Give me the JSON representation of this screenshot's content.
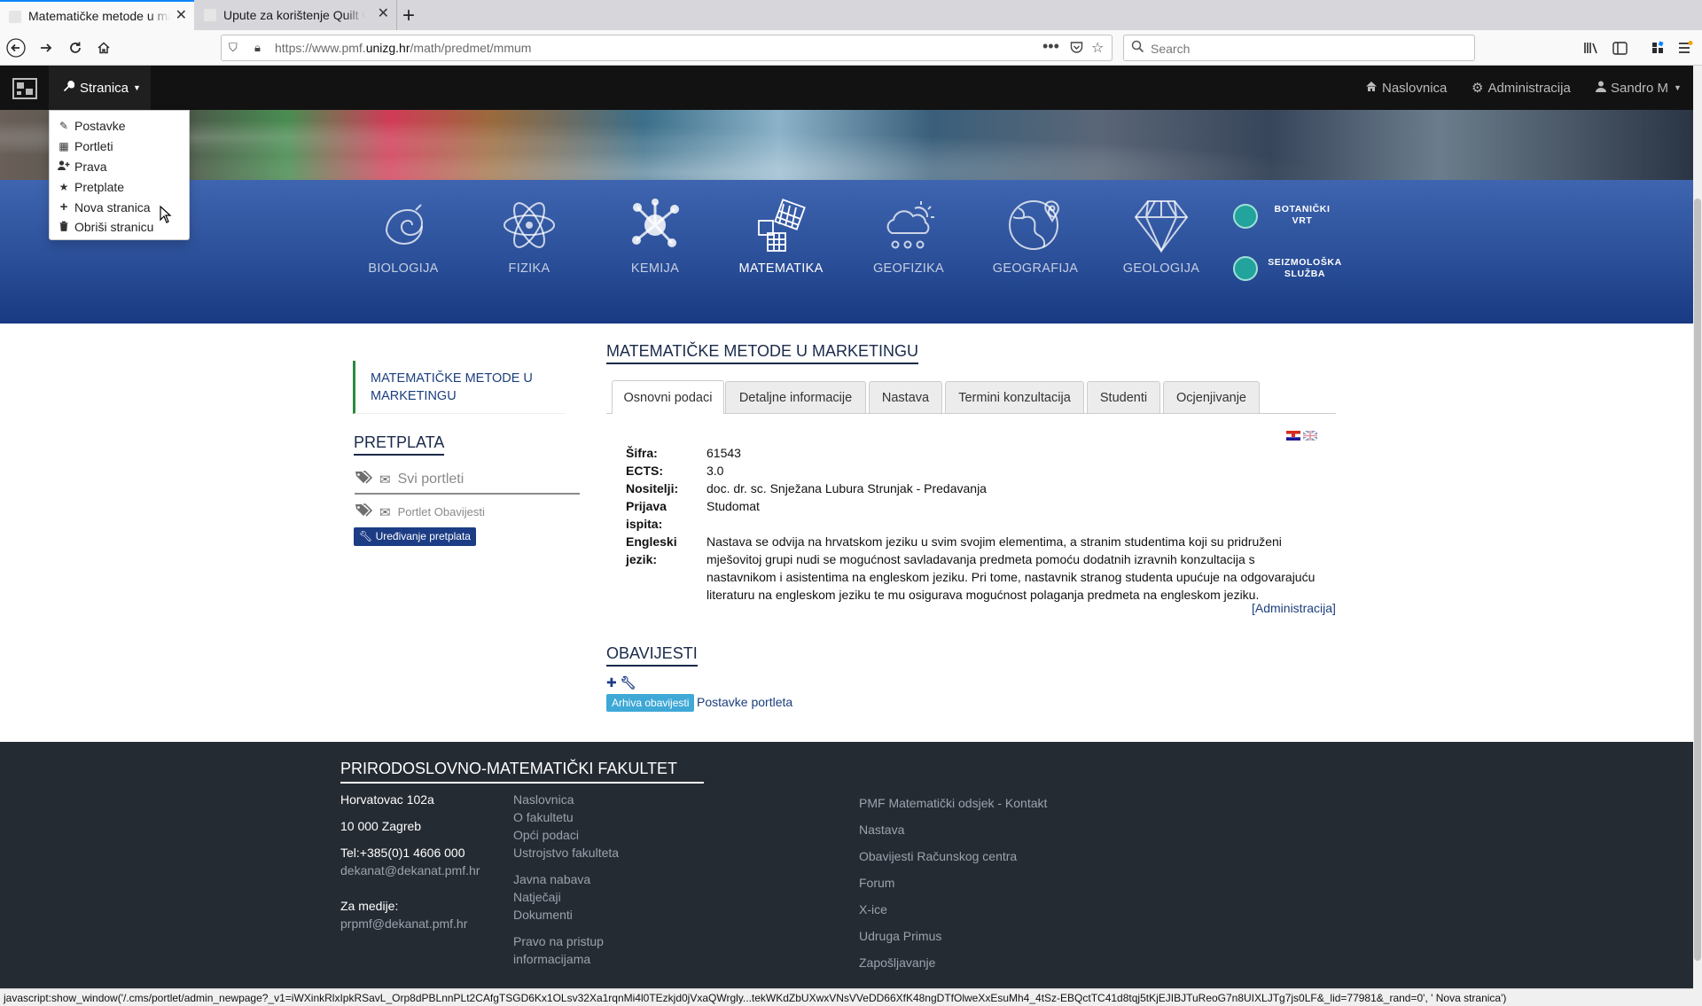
{
  "browser": {
    "tabs": [
      {
        "title": "Matematičke metode u marketingu"
      },
      {
        "title": "Upute za korištenje Quilt CMS"
      }
    ],
    "url_prefix": "https://www.pmf.",
    "url_domain": "unizg.hr",
    "url_path": "/math/predmet/mmum",
    "search_placeholder": "Search"
  },
  "topbar": {
    "menu_label": "Stranica",
    "nav": [
      "Naslovnica",
      "Administracija",
      "Sandro M"
    ]
  },
  "dropdown": {
    "items": [
      {
        "label": "Postavke",
        "icon": "edit-icon"
      },
      {
        "label": "Portleti",
        "icon": "grid-icon"
      },
      {
        "label": "Prava",
        "icon": "user-plus-icon"
      },
      {
        "label": "Pretplate",
        "icon": "star-icon"
      },
      {
        "label": "Nova stranica",
        "icon": "plus-icon"
      },
      {
        "label": "Obriši stranicu",
        "icon": "trash-icon"
      }
    ]
  },
  "disciplines": [
    {
      "label": "BIOLOGIJA",
      "icon": "shell-icon"
    },
    {
      "label": "FIZIKA",
      "icon": "atom-icon"
    },
    {
      "label": "KEMIJA",
      "icon": "molecule-icon"
    },
    {
      "label": "MATEMATIKA",
      "icon": "geometry-icon"
    },
    {
      "label": "GEOFIZIKA",
      "icon": "cloud-sun-icon"
    },
    {
      "label": "GEOGRAFIJA",
      "icon": "globe-icon"
    },
    {
      "label": "GEOLOGIJA",
      "icon": "diamond-icon"
    }
  ],
  "mini_links": [
    {
      "line1": "BOTANIČKI",
      "line2": "VRT"
    },
    {
      "line1": "SEIZMOLOŠKA",
      "line2": "SLUŽBA"
    }
  ],
  "sidebar": {
    "course_link_line1": "MATEMATIČKE METODE U",
    "course_link_line2": "MARKETINGU",
    "pretplata_title": "PRETPLATA",
    "svi_portleti": "Svi portleti",
    "portlet_obavijesti": "Portlet Obavijesti",
    "edit_button": "Uređivanje pretplata"
  },
  "content": {
    "title": "MATEMATIČKE METODE U MARKETINGU",
    "tabs": [
      "Osnovni podaci",
      "Detaljne informacije",
      "Nastava",
      "Termini konzultacija",
      "Studenti",
      "Ocjenjivanje"
    ],
    "info": [
      {
        "label": "Šifra:",
        "value": "61543"
      },
      {
        "label": "ECTS:",
        "value": "3.0"
      },
      {
        "label": "Nositelji:",
        "value": "doc. dr. sc. Snježana Lubura Strunjak - Predavanja"
      },
      {
        "label": "Prijava ispita:",
        "value": "Studomat"
      },
      {
        "label": "Engleski jezik:",
        "value": "Nastava se odvija na hrvatskom jeziku u svim svojim elementima, a stranim studentima koji su pridruženi mješovitoj grupi nudi se mogućnost savladavanja predmeta pomoću dodatnih izravnih konzultacija s nastavnikom i asistentima na engleskom jeziku. Pri tome, nastavnik stranog studenta upućuje na odgovarajuću literaturu na engleskom jeziku te mu osigurava mogućnost polaganja predmeta na engleskom jeziku."
      }
    ],
    "admin_link": "[Administracija]",
    "obavijesti_title": "OBAVIJESTI",
    "arhiva_button": "Arhiva obavijesti",
    "postavke_portleta": "Postavke portleta"
  },
  "footer": {
    "title": "PRIRODOSLOVNO-MATEMATIČKI FAKULTET",
    "address1": "Horvatovac 102a",
    "address2": "10 000 Zagreb",
    "tel": "Tel:+385(0)1 4606 000",
    "email": "dekanat@dekanat.pmf.hr",
    "media_label": "Za medije:",
    "media_email": "prpmf@dekanat.pmf.hr",
    "col2": [
      "Naslovnica",
      "O fakultetu",
      "Opći podaci",
      "Ustrojstvo fakulteta",
      "Javna nabava",
      "Natječaji",
      "Dokumenti",
      "Pravo na pristup",
      "informacijama"
    ],
    "col3": [
      "PMF Matematički odsjek - Kontakt",
      "Nastava",
      "Obavijesti Računskog centra",
      "Forum",
      "X-ice",
      "Udruga Primus",
      "Zapošljavanje"
    ]
  },
  "statusbar": "javascript:show_window('/.cms/portlet/admin_newpage?_v1=iWXinkRlxIpkRSavL_Orp8dPBLnnPLt2CAfgTSGD6Kx1OLsv32Xa1rqnMi4l0TEzkjd0jVxaQWrgly...tekWKdZbUXwxVNsVVeDD66XfK48ngDTfOlweXxEsuMh4_4tSz-EBQctTC41d8tqj5tKjEJIBJTuReoG7n8UIXLJTg7js0LF&_lid=77981&_rand=0', ' Nova stranica')"
}
